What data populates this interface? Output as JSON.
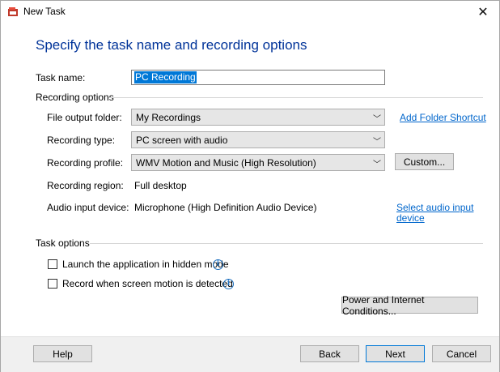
{
  "window": {
    "title": "New Task"
  },
  "heading": "Specify the task name and recording options",
  "task_name": {
    "label": "Task name:",
    "value": "PC Recording"
  },
  "recording_options": {
    "group_label": "Recording options",
    "file_output_folder": {
      "label": "File output folder:",
      "value": "My Recordings",
      "link": "Add Folder Shortcut"
    },
    "recording_type": {
      "label": "Recording type:",
      "value": "PC screen with audio"
    },
    "recording_profile": {
      "label": "Recording profile:",
      "value": "WMV Motion and Music (High Resolution)",
      "button": "Custom..."
    },
    "recording_region": {
      "label": "Recording region:",
      "value": "Full desktop"
    },
    "audio_input": {
      "label": "Audio input device:",
      "value": "Microphone (High Definition Audio Device)",
      "link_line1": "Select audio input",
      "link_line2": "device"
    }
  },
  "task_options": {
    "group_label": "Task options",
    "launch_hidden": {
      "label": "Launch the application in hidden mode",
      "checked": false
    },
    "record_on_motion": {
      "label": "Record when screen motion is detected",
      "checked": false
    },
    "power_button": "Power and Internet Conditions..."
  },
  "footer": {
    "help": "Help",
    "back": "Back",
    "next": "Next",
    "cancel": "Cancel"
  },
  "icons": {
    "app": "app-icon",
    "close": "close-icon",
    "info": "info-icon",
    "dropdown": "chevron-down-icon"
  },
  "colors": {
    "heading": "#003399",
    "link": "#0066cc",
    "selection": "#0078d7"
  }
}
